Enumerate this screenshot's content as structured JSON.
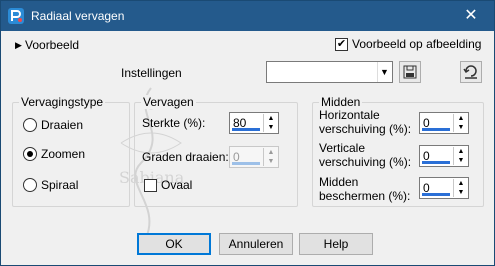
{
  "window": {
    "title": "Radiaal vervagen"
  },
  "preview": {
    "toggle_label": "Voorbeeld",
    "checkbox_label": "Voorbeeld op afbeelding",
    "checked": true
  },
  "settings": {
    "label": "Instellingen",
    "value": ""
  },
  "vervagingstype": {
    "title": "Vervagingstype",
    "options": [
      {
        "label": "Draaien",
        "checked": false
      },
      {
        "label": "Zoomen",
        "checked": true
      },
      {
        "label": "Spiraal",
        "checked": false
      }
    ]
  },
  "vervagen": {
    "title": "Vervagen",
    "strength_label": "Sterkte (%):",
    "strength_value": "80",
    "degrees_label": "Graden draaien:",
    "degrees_value": "0",
    "oval_label": "Ovaal",
    "oval_checked": false
  },
  "midden": {
    "title": "Midden",
    "horizontal_label_1": "Horizontale",
    "horizontal_label_2": "verschuiving (%):",
    "horizontal_value": "0",
    "vertical_label_1": "Verticale",
    "vertical_label_2": "verschuiving (%):",
    "vertical_value": "0",
    "protect_label_1": "Midden",
    "protect_label_2": "beschermen (%):",
    "protect_value": "0"
  },
  "buttons": {
    "ok": "OK",
    "cancel": "Annuleren",
    "help": "Help"
  },
  "watermark_text": "Sabiana"
}
